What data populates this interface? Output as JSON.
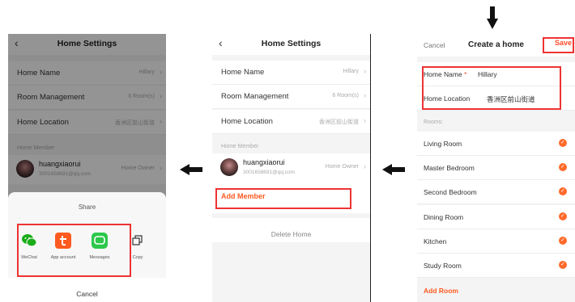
{
  "settings": {
    "title": "Home Settings",
    "rows": [
      {
        "label": "Home Name",
        "value": "Hillary"
      },
      {
        "label": "Room Management",
        "value": "6 Room(s)"
      },
      {
        "label": "Home Location",
        "value": "香洲区前山街道"
      }
    ],
    "member_section": "Home Member",
    "member": {
      "name": "huangxiaorui",
      "email": "3001658691@qq.com",
      "role": "Home Owner"
    },
    "add_member": "Add Member",
    "delete_home": "Delete Home"
  },
  "share": {
    "title": "Share",
    "items": [
      {
        "label": "WeChat",
        "icon": "wechat-icon",
        "color": "#1aad19"
      },
      {
        "label": "App account",
        "icon": "app-account-icon",
        "color": "#ff5a1f"
      },
      {
        "label": "Messages",
        "icon": "messages-icon",
        "color": "#2bc84a"
      },
      {
        "label": "Copy",
        "icon": "copy-icon",
        "color": "#333333"
      }
    ],
    "cancel": "Cancel"
  },
  "create": {
    "cancel": "Cancel",
    "title": "Create a home",
    "save": "Save",
    "name_label": "Home Name",
    "name_value": "Hillary",
    "location_label": "Home Location",
    "location_value": "香洲区前山街道",
    "rooms_section": "Rooms:",
    "rooms": [
      "Living Room",
      "Master Bedroom",
      "Second Bedroom",
      "Dining Room",
      "Kitchen",
      "Study Room"
    ],
    "add_room": "Add Room"
  },
  "colors": {
    "accent": "#ff5a1f",
    "highlight": "#e33333"
  }
}
